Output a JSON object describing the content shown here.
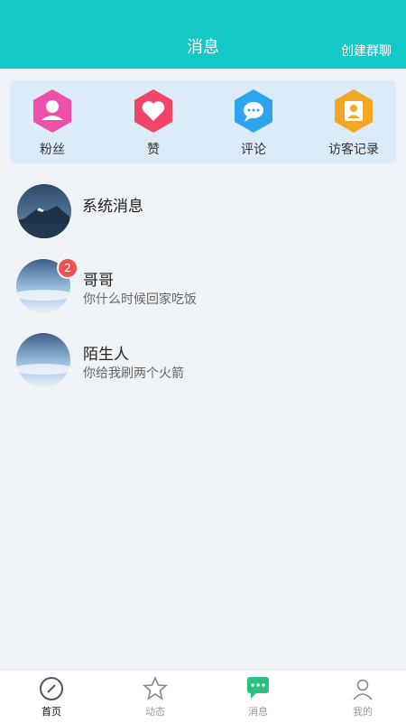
{
  "header": {
    "title": "消息",
    "action": "创建群聊"
  },
  "quick_actions": [
    {
      "label": "粉丝",
      "icon": "fans-icon",
      "color": "#f04fa9"
    },
    {
      "label": "赞",
      "icon": "heart-icon",
      "color": "#f04468"
    },
    {
      "label": "评论",
      "icon": "comment-icon",
      "color": "#2fa4ee"
    },
    {
      "label": "访客记录",
      "icon": "visitor-icon",
      "color": "#f5a623"
    }
  ],
  "messages": [
    {
      "name": "系统消息",
      "preview": "",
      "badge": ""
    },
    {
      "name": "哥哥",
      "preview": "你什么时候回家吃饭",
      "badge": "2"
    },
    {
      "name": "陌生人",
      "preview": "你给我刷两个火箭",
      "badge": ""
    }
  ],
  "tabbar": [
    {
      "label": "首页",
      "icon": "compass-icon",
      "active": true
    },
    {
      "label": "动态",
      "icon": "star-icon",
      "active": false
    },
    {
      "label": "消息",
      "icon": "chat-icon",
      "active": false
    },
    {
      "label": "我的",
      "icon": "profile-icon",
      "active": false
    }
  ],
  "colors": {
    "header": "#12c9c6",
    "badge": "#f05151"
  }
}
